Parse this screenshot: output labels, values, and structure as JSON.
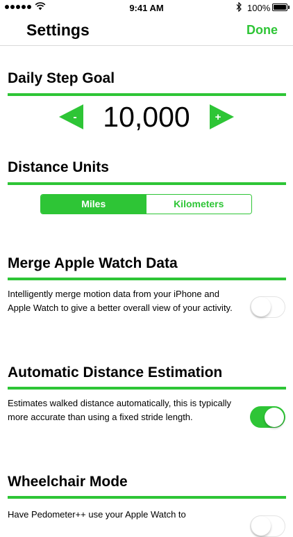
{
  "status_bar": {
    "time": "9:41 AM",
    "battery": "100%",
    "icons": [
      "signal-dots-icon",
      "wifi-icon",
      "bluetooth-icon",
      "battery-icon"
    ]
  },
  "nav": {
    "title": "Settings",
    "done_label": "Done"
  },
  "step_goal": {
    "title": "Daily Step Goal",
    "value": "10,000",
    "decrease_symbol": "-",
    "increase_symbol": "+"
  },
  "distance_units": {
    "title": "Distance Units",
    "options": [
      "Miles",
      "Kilometers"
    ],
    "selected": "Miles"
  },
  "merge_watch": {
    "title": "Merge Apple Watch Data",
    "description": "Intelligently merge motion data from your iPhone and Apple Watch to give a better overall view of your activity.",
    "enabled": false
  },
  "auto_distance": {
    "title": "Automatic Distance Estimation",
    "description": "Estimates walked distance automatically, this is typically more accurate than using a fixed stride length.",
    "enabled": true
  },
  "wheelchair": {
    "title": "Wheelchair Mode",
    "description": "Have Pedometer++ use your Apple Watch to",
    "enabled": false
  },
  "colors": {
    "accent": "#2ec536",
    "toggle_off_border": "#e3e3e3",
    "divider": "#d9d9d9"
  }
}
